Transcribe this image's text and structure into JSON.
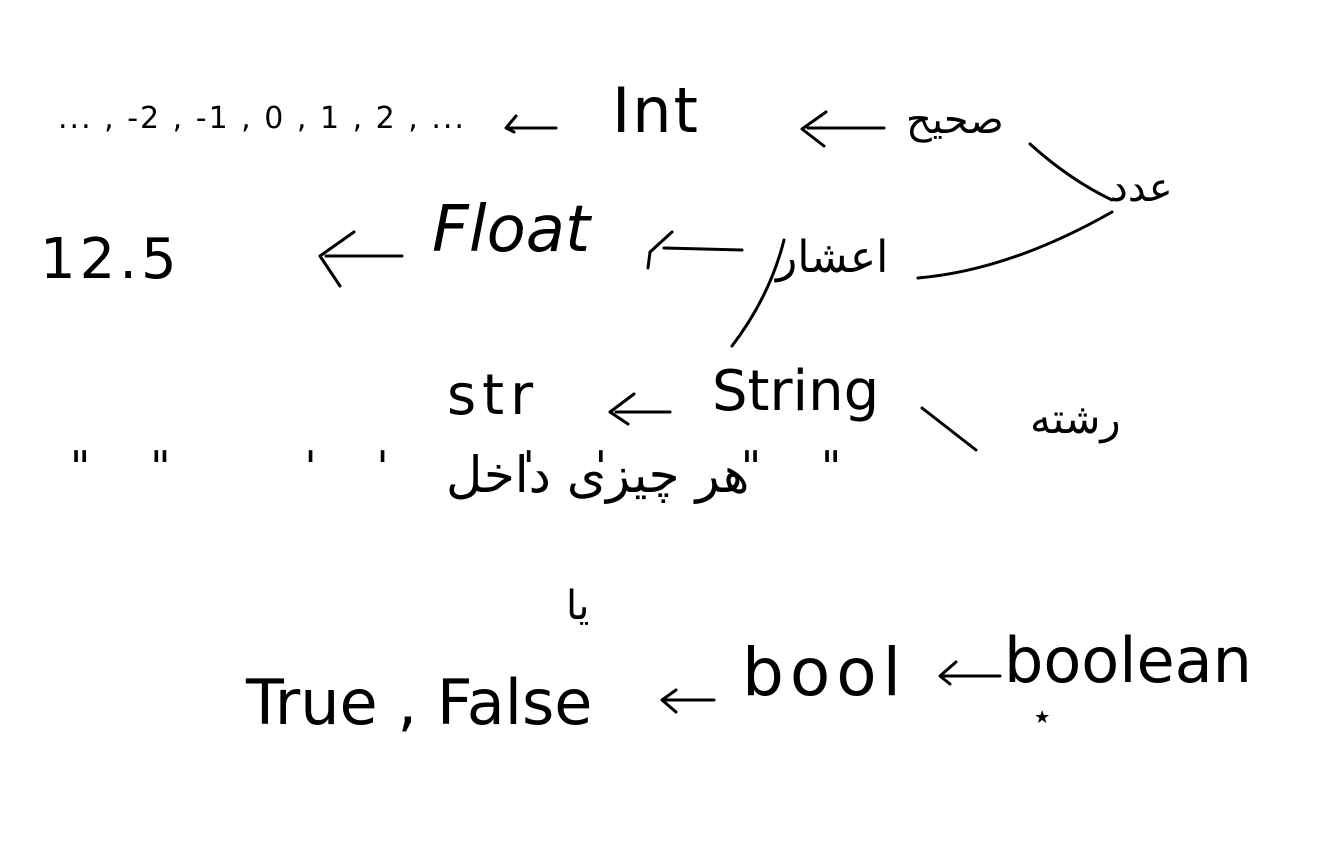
{
  "diagram": {
    "words": {
      "int": "Int",
      "int_examples": "... , -2 , -1 , 0 , 1 , 2 , ...",
      "float": "Float",
      "float_example": "12.5",
      "str": "str",
      "string": "String",
      "bool": "bool",
      "boolean": "boolean",
      "bool_values": "True , False"
    },
    "persian_words": {
      "adad": "عدد",
      "sahih": "صحیح",
      "ashar": "اعشار",
      "reshte": "رشته",
      "hargune": "هر چیزی داخل",
      "quotes": "\"\"  ''  ''  \"\"",
      "ya": "یا",
      "mark": "٭"
    }
  }
}
